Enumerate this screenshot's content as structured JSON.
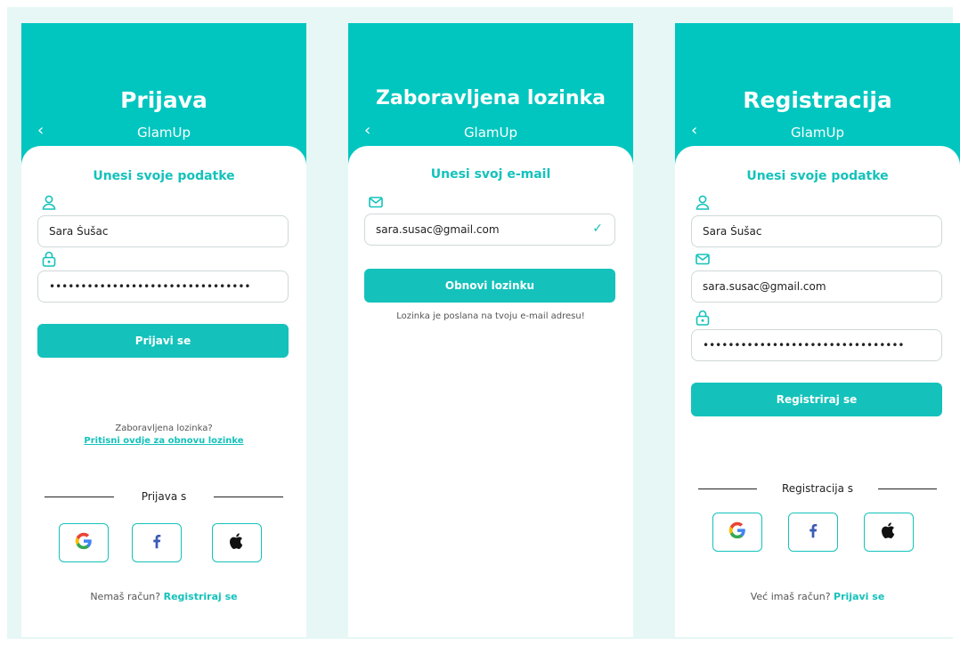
{
  "colors": {
    "accent": "#14c2bb",
    "header": "#00c6bf",
    "backdrop": "#e6f7f6"
  },
  "screens": {
    "login": {
      "title": "Prijava",
      "subtitle": "GlamUp",
      "back_icon": "chevron-left-icon",
      "heading": "Unesi svoje podatke",
      "username_value": "Sara Šušac",
      "password_value": "••••••••••••••••••••••••••••••••",
      "submit_label": "Prijavi se",
      "forgot_question": "Zaboravljena lozinka?",
      "forgot_link": "Pritisni ovdje za obnovu lozinke",
      "divider_label": "Prijava s",
      "bottom_text": "Nemaš račun?",
      "bottom_link": "Registriraj se"
    },
    "forgot": {
      "title": "Zaboravljena lozinka",
      "subtitle": "GlamUp",
      "back_icon": "chevron-left-icon",
      "heading": "Unesi svoj e-mail",
      "email_value": "sara.susac@gmail.com",
      "submit_label": "Obnovi lozinku",
      "confirmation": "Lozinka je poslana na tvoju e-mail adresu!"
    },
    "register": {
      "title": "Registracija",
      "subtitle": "GlamUp",
      "back_icon": "chevron-left-icon",
      "heading": "Unesi svoje podatke",
      "name_value": "Sara Šušac",
      "email_value": "sara.susac@gmail.com",
      "password_value": "••••••••••••••••••••••••••••••••",
      "submit_label": "Registriraj se",
      "divider_label": "Registracija s",
      "bottom_text": "Već imaš račun?",
      "bottom_link": "Prijavi se"
    }
  },
  "social_icons": [
    "google-icon",
    "facebook-icon",
    "apple-icon"
  ]
}
